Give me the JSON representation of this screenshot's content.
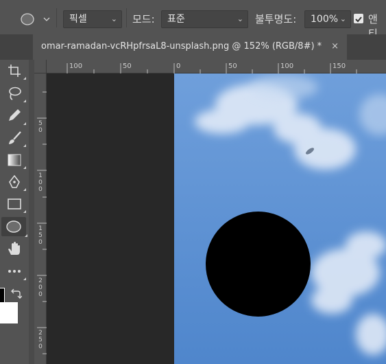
{
  "options_bar": {
    "unit_dropdown": "픽셀",
    "mode_label": "모드:",
    "mode_value": "표준",
    "opacity_label": "불투명도:",
    "opacity_value": "100%",
    "antialias_label": "앤티"
  },
  "document_tab": {
    "title": "omar-ramadan-vcRHpfrsaL8-unsplash.png @ 152% (RGB/8#) *",
    "close": "×"
  },
  "ruler": {
    "h_labels": [
      "100",
      "50",
      "0",
      "50",
      "100",
      "150"
    ],
    "v_labels": [
      "5\n0",
      "1\n0\n0",
      "1\n5\n0",
      "2\n0\n0",
      "2\n5\n0"
    ]
  },
  "tools": [
    "artboard-icon",
    "lasso-icon",
    "pen-icon",
    "brush-icon",
    "gradient-icon",
    "pen-tool-icon",
    "rectangle-icon",
    "ellipse-icon",
    "hand-icon",
    "more-tools-icon"
  ],
  "colors": {
    "canvas_sky": "#5a8dd0",
    "circle": "#000000",
    "foreground": "#000000",
    "background": "#ffffff"
  }
}
